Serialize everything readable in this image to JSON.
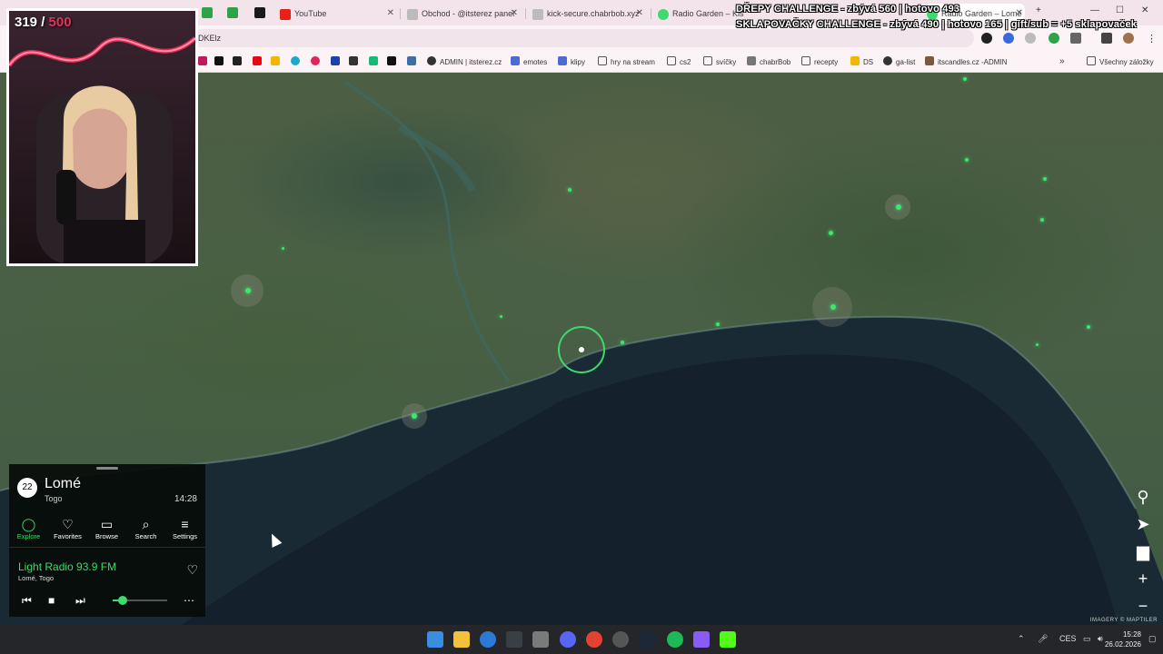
{
  "browser": {
    "tabs": [
      {
        "label": "YouTube",
        "icon": "youtube-icon"
      },
      {
        "label": "Obchod - @itsterez panel",
        "icon": "shop-icon"
      },
      {
        "label": "kick-secure.chabrbob.xyz",
        "icon": "kick-icon"
      },
      {
        "label": "Radio Garden – Kis",
        "icon": "radio-garden-icon"
      },
      {
        "label": "Radio Garden – Lomé",
        "icon": "radio-garden-icon"
      }
    ],
    "address_fragment": "DKElz",
    "bookmarks": [
      "ADMIN | itsterez.cz",
      "emotes",
      "klipy",
      "hry na stream",
      "cs2",
      "svíčky",
      "chabrBob",
      "recepty",
      "DS",
      "ga-list",
      "itscandles.cz -ADMIN"
    ],
    "all_bookmarks": "Všechny záložky"
  },
  "stream": {
    "challenge_1": "DŘEPY CHALLENGE - zbývá 560 | hotovo 493",
    "challenge_2": "SKLAPOVAČKY CHALLENGE - zbývá 490 | hotovo 165 | gift/sub = +5 sklapovaček",
    "counter_current": "319",
    "counter_sep": " / ",
    "counter_goal": "500"
  },
  "radio": {
    "station_count": "22",
    "city": "Lomé",
    "country": "Togo",
    "local_time": "14:28",
    "nav": [
      {
        "label": "Explore",
        "icon": "explore-icon",
        "glyph": "◯"
      },
      {
        "label": "Favorites",
        "icon": "heart-icon",
        "glyph": "♡"
      },
      {
        "label": "Browse",
        "icon": "map-icon",
        "glyph": "▭"
      },
      {
        "label": "Search",
        "icon": "search-icon",
        "glyph": "⌕"
      },
      {
        "label": "Settings",
        "icon": "menu-icon",
        "glyph": "≡"
      }
    ],
    "station_name": "Light Radio 93.9 FM",
    "station_location": "Lomé, Togo",
    "volume": 0.18,
    "accent": "#3fd96e"
  },
  "map": {
    "attribution": "IMAGERY © MAPTILER",
    "tools": [
      "radio-garden-logo-icon",
      "locate-icon",
      "lock-icon",
      "zoom-in-icon",
      "zoom-out-icon"
    ]
  },
  "taskbar": {
    "tray_lang": "CES",
    "time": "15:28",
    "date": "26.02.2026"
  }
}
